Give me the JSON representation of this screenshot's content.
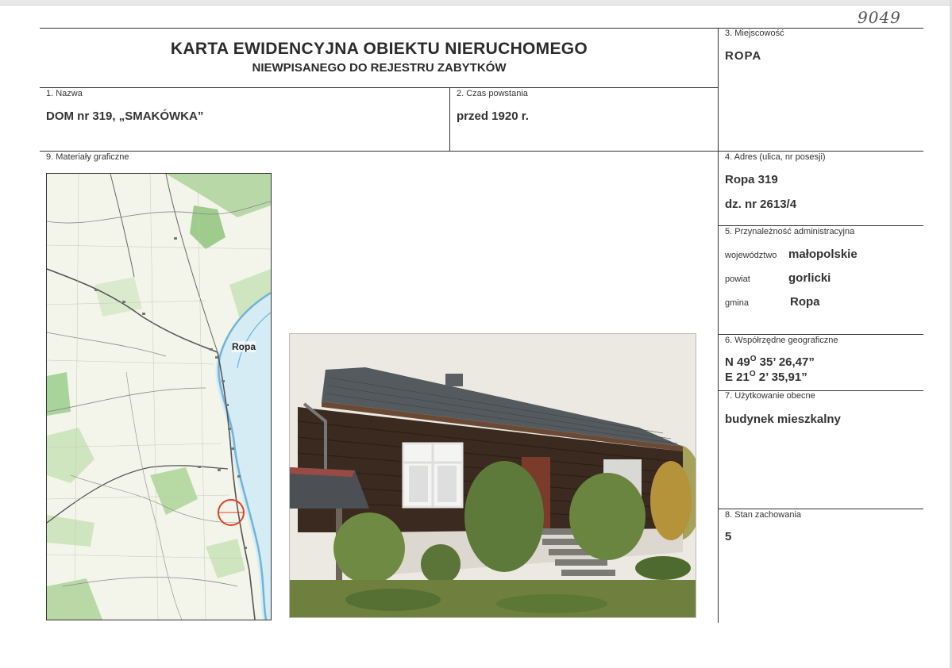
{
  "handwritten_number": "9049",
  "header": {
    "title": "KARTA EWIDENCYJNA OBIEKTU NIERUCHOMEGO",
    "subtitle": "NIEWPISANEGO DO REJESTRU ZABYTKÓW"
  },
  "fields": {
    "nazwa": {
      "label": "1. Nazwa",
      "value": "DOM nr 319, „SMAKÓWKA”"
    },
    "czas": {
      "label": "2. Czas powstania",
      "value": "przed 1920 r."
    },
    "miejscowosc": {
      "label": "3. Miejscowość",
      "value": "ROPA"
    },
    "adres": {
      "label": "4. Adres (ulica, nr posesji)",
      "line1": "Ropa 319",
      "line2": "dz. nr 2613/4"
    },
    "przynaleznosc": {
      "label": "5. Przynależność administracyjna",
      "rows": [
        {
          "key": "województwo",
          "value": "małopolskie"
        },
        {
          "key": "powiat",
          "value": "gorlicki"
        },
        {
          "key": "gmina",
          "value": "Ropa"
        }
      ]
    },
    "wspolrzedne": {
      "label": "6. Współrzędne geograficzne",
      "n": {
        "prefix": "N 49",
        "deg": "O",
        "rest": " 35’ 26,47”"
      },
      "e": {
        "prefix": "E 21",
        "deg": "O",
        "rest": " 2’ 35,91”"
      }
    },
    "uzytkowanie": {
      "label": "7. Użytkowanie obecne",
      "value": "budynek mieszkalny"
    },
    "stan": {
      "label": "8. Stan zachowania",
      "value": "5"
    },
    "materialy": {
      "label": "9. Materiały graficzne"
    }
  },
  "map": {
    "place_label": "Ropa"
  },
  "colors": {
    "line": "#333333",
    "text": "#333333",
    "marker": "#e0402a"
  }
}
